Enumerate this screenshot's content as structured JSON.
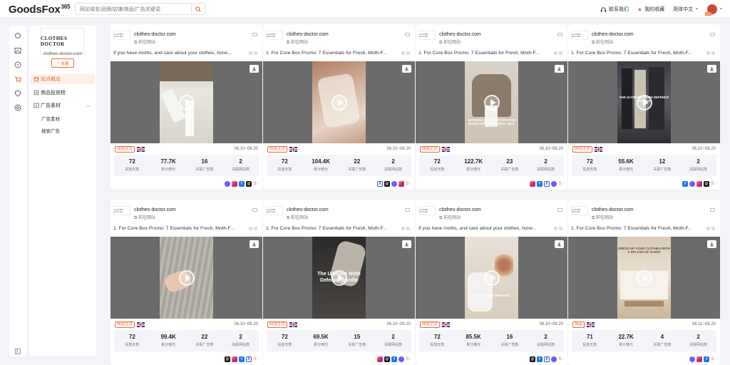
{
  "header": {
    "logo_text": "GoodsFox",
    "logo_suffix": "365",
    "search_placeholder": "网站域名/品牌/店铺/商品/广告关键词",
    "contact_label": "联系我们",
    "favorites_label": "我的收藏",
    "language_label": "简体中文",
    "vip_badge": "VIP"
  },
  "sidebar": {
    "brand_logo_text": "CLOTHES DOCTOR",
    "brand_name": "clothes-doctor.com",
    "favorite_button": "收藏",
    "nav": [
      {
        "label": "站点概览",
        "active": true,
        "icon": "store-icon"
      },
      {
        "label": "商品投放榜",
        "active": false,
        "icon": "ranking-icon"
      },
      {
        "label": "广告素材",
        "active": false,
        "icon": "media-icon"
      }
    ],
    "sub_items": [
      "广告素材",
      "搜索广告"
    ]
  },
  "card_common": {
    "logo_text": "CLOTHES DOCTOR",
    "domain": "clothes-doctor.com",
    "link_label": "前往网站",
    "stat_labels": [
      "投放天数",
      "累计曝光",
      "关联广告数",
      "关联网站数"
    ]
  },
  "cards": [
    {
      "text": "If you have moths, and care about your clothes, hone...",
      "tag": "网站主页",
      "date": "06.10~08.20",
      "stats": [
        "72",
        "77.7K",
        "16",
        "2"
      ],
      "platforms": [
        "messenger",
        "instagram",
        "facebook",
        "threads"
      ],
      "more": "5",
      "caption": "",
      "thumb": "bottles"
    },
    {
      "text": "1. For Core Box Promo: 7 Essentials for Fresh, Moth-F...",
      "tag": "网站主页",
      "date": "06.10~08.20",
      "stats": [
        "72",
        "104.4K",
        "22",
        "2"
      ],
      "platforms": [
        "audience",
        "threads",
        "messenger",
        "instagram"
      ],
      "more": "5",
      "caption": "",
      "thumb": "fabric"
    },
    {
      "text": "1. For Core Box Promo: 7 Essentials for Fresh, Moth-F...",
      "tag": "网站主页",
      "date": "06.10~08.20",
      "stats": [
        "72",
        "122.7K",
        "23",
        "2"
      ],
      "platforms": [
        "instagram",
        "facebook",
        "audience",
        "messenger"
      ],
      "more": "5",
      "caption": "NATURAL MOTH PROTECTION MADE WITH ESSENTIAL OILS",
      "thumb": "sweater"
    },
    {
      "text": "1. For Core Box Promo: 7 Essentials for Fresh, Moth-F...",
      "tag": "网站主页",
      "date": "06.10~08.20",
      "stats": [
        "72",
        "55.6K",
        "12",
        "2"
      ],
      "platforms": [
        "facebook",
        "messenger",
        "instagram",
        "threads"
      ],
      "more": "5",
      "caption": "The Ultimate Moth Defence Bundle",
      "thumb": "rack"
    },
    {
      "text": "1. For Core Box Promo: 7 Essentials for Fresh, Moth-F...",
      "tag": "网站主页",
      "date": "06.10~08.20",
      "stats": [
        "72",
        "99.4K",
        "22",
        "2"
      ],
      "platforms": [
        "threads",
        "instagram",
        "facebook",
        "audience"
      ],
      "more": "5",
      "caption": "",
      "thumb": "knit"
    },
    {
      "text": "1. For Core Box Promo: 7 Essentials for Fresh, Moth-F...",
      "tag": "网站主页",
      "date": "06.10~08.20",
      "stats": [
        "72",
        "69.5K",
        "15",
        "2"
      ],
      "platforms": [
        "instagram",
        "threads",
        "facebook",
        "messenger"
      ],
      "more": "5",
      "caption": "The Ultimate Moth Defence Bundle",
      "thumb": "dark"
    },
    {
      "text": "If you have moths, and care about your clothes, hone...",
      "tag": "网站主页",
      "date": "06.10~08.20",
      "stats": [
        "72",
        "85.5K",
        "16",
        "2"
      ],
      "platforms": [
        "threads",
        "facebook",
        "audience",
        "messenger"
      ],
      "more": "5",
      "caption": "JUST A FEW SPRITZES",
      "thumb": "flowers"
    },
    {
      "text": "1. For Core Box Promo: 7 Essentials for Fresh, Moth-F...",
      "tag": "商品",
      "date": "06.11~08.20",
      "stats": [
        "71",
        "22.7K",
        "4",
        "2"
      ],
      "platforms": [
        "messenger",
        "instagram",
        "facebook"
      ],
      "more": "5",
      "caption": "DRESS UP YOUR CLOTHES WITH A SPLASH OF SCENT",
      "thumb": "shelf"
    }
  ],
  "colors": {
    "accent": "#f06a35",
    "media_bg": "#6b6b6b",
    "stats_bg": "#f3f5fa"
  }
}
